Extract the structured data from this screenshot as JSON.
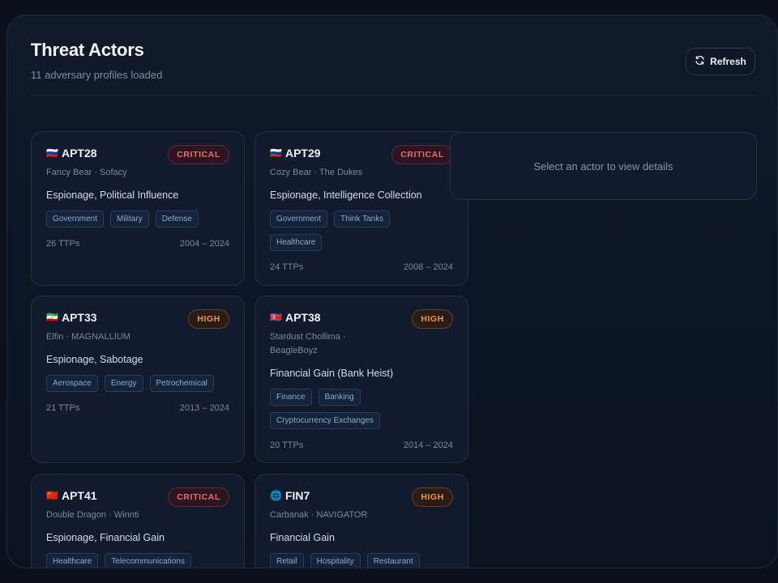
{
  "page": {
    "title": "Threat Actors",
    "subtitle": "11 adversary profiles loaded",
    "refresh_label": "Refresh",
    "detail_placeholder": "Select an actor to view details"
  },
  "colors": {
    "critical": "#f06a6a",
    "high": "#f0964a",
    "background": "#0a111d",
    "card": "#111b2d"
  },
  "actors": [
    {
      "flag": "🇷🇺",
      "name": "APT28",
      "severity": "CRITICAL",
      "aliases": "Fancy Bear · Sofacy",
      "motivation": "Espionage, Political Influence",
      "tags": [
        "Government",
        "Military",
        "Defense"
      ],
      "ttps": "26 TTPs",
      "years": "2004 – 2024"
    },
    {
      "flag": "🇷🇺",
      "name": "APT29",
      "severity": "CRITICAL",
      "aliases": "Cozy Bear · The Dukes",
      "motivation": "Espionage, Intelligence Collection",
      "tags": [
        "Government",
        "Think Tanks",
        "Healthcare"
      ],
      "ttps": "24 TTPs",
      "years": "2008 – 2024"
    },
    {
      "flag": "🇮🇷",
      "name": "APT33",
      "severity": "HIGH",
      "aliases": "Elfin · MAGNALLIUM",
      "motivation": "Espionage, Sabotage",
      "tags": [
        "Aerospace",
        "Energy",
        "Petrochemical"
      ],
      "ttps": "21 TTPs",
      "years": "2013 – 2024"
    },
    {
      "flag": "🇰🇵",
      "name": "APT38",
      "severity": "HIGH",
      "aliases": "Stardust Chollima · BeagleBoyz",
      "motivation": "Financial Gain (Bank Heist)",
      "tags": [
        "Finance",
        "Banking",
        "Cryptocurrency Exchanges"
      ],
      "ttps": "20 TTPs",
      "years": "2014 – 2024"
    },
    {
      "flag": "🇨🇳",
      "name": "APT41",
      "severity": "CRITICAL",
      "aliases": "Double Dragon · Winnti",
      "motivation": "Espionage, Financial Gain",
      "tags": [
        "Healthcare",
        "Telecommunications"
      ],
      "ttps": "",
      "years": ""
    },
    {
      "flag": "🌐",
      "name": "FIN7",
      "severity": "HIGH",
      "aliases": "Carbanak · NAVIGATOR",
      "motivation": "Financial Gain",
      "tags": [
        "Retail",
        "Hospitality",
        "Restaurant"
      ],
      "ttps": "",
      "years": ""
    }
  ]
}
